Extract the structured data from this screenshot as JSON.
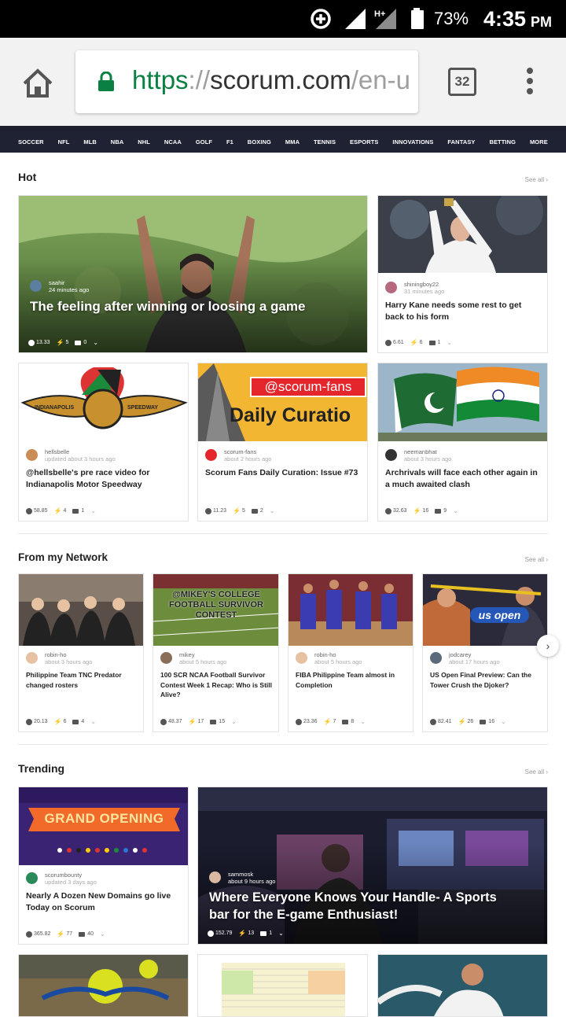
{
  "status_bar": {
    "battery": "73%",
    "time": "4:35",
    "ampm": "PM",
    "network": "H+"
  },
  "browser": {
    "url_scheme": "https",
    "url_sep": "://",
    "url_host": "scorum.com",
    "url_path": "/en-u",
    "tab_count": "32"
  },
  "sport_nav": [
    "SOCCER",
    "NFL",
    "MLB",
    "NBA",
    "NHL",
    "NCAA",
    "GOLF",
    "F1",
    "BOXING",
    "MMA",
    "TENNIS",
    "ESPORTS",
    "INNOVATIONS",
    "FANTASY",
    "BETTING",
    "MORE"
  ],
  "sections": {
    "hot": {
      "title": "Hot",
      "see_all": "See all ›"
    },
    "network": {
      "title": "From my Network",
      "see_all": "See all ›"
    },
    "trending": {
      "title": "Trending",
      "see_all": "See all ›"
    }
  },
  "hot_cards": [
    {
      "author": "saahir",
      "ago": "24 minutes ago",
      "title": "The feeling after winning or loosing a game",
      "payout": "13.33",
      "votes": "5",
      "comments": "0"
    },
    {
      "author": "shiningboy22",
      "ago": "31 minutes ago",
      "title": "Harry Kane needs some rest to get back to his form",
      "payout": "6.61",
      "votes": "6",
      "comments": "1"
    },
    {
      "author": "hellsbelle",
      "ago": "updated about 3 hours ago",
      "title": "@hellsbelle's pre race video for Indianapolis Motor Speedway",
      "payout": "58.85",
      "votes": "4",
      "comments": "1",
      "img_text": "INDIANAPOLIS MOTOR SPEEDWAY"
    },
    {
      "author": "scorum-fans",
      "ago": "about 2 hours ago",
      "title": "Scorum Fans Daily Curation: Issue #73",
      "payout": "11.23",
      "votes": "5",
      "comments": "2",
      "img_tag": "@scorum-fans",
      "img_text": "Daily Curatio"
    },
    {
      "author": "neemanbhat",
      "ago": "about 3 hours ago",
      "title": "Archrivals will face each other again in a much awaited clash",
      "payout": "32.63",
      "votes": "16",
      "comments": "9"
    }
  ],
  "network_cards": [
    {
      "author": "robin-ho",
      "ago": "about 3 hours ago",
      "title": "Philippine Team TNC Predator changed rosters",
      "payout": "20.13",
      "votes": "6",
      "comments": "4"
    },
    {
      "author": "mikey",
      "ago": "about 5 hours ago",
      "title": "100 SCR NCAA Football Survivor Contest Week 1 Recap: Who is Still Alive?",
      "payout": "48.37",
      "votes": "17",
      "comments": "15",
      "img_text": "@MIKEY'S COLLEGE FOOTBALL SURVIVOR CONTEST"
    },
    {
      "author": "robin-ho",
      "ago": "about 5 hours ago",
      "title": "FIBA Philippine Team almost in Completion",
      "payout": "23.36",
      "votes": "7",
      "comments": "8"
    },
    {
      "author": "jodcarey",
      "ago": "about 17 hours ago",
      "title": "US Open Final Preview: Can the Tower Crush the Djoker?",
      "payout": "82.41",
      "votes": "26",
      "comments": "16",
      "img_text": "us open"
    }
  ],
  "trending_cards": [
    {
      "author": "scorumbounty",
      "ago": "updated 3 days ago",
      "title": "Nearly A Dozen New Domains go live Today on Scorum",
      "payout": "365.82",
      "votes": "77",
      "comments": "40",
      "img_text": "GRAND OPENING"
    },
    {
      "author": "sammosk",
      "ago": "about 9 hours ago",
      "title": "Where Everyone Knows Your Handle- A Sports bar for the E-game Enthusiast!",
      "payout": "152.79",
      "votes": "13",
      "comments": "1"
    }
  ],
  "colors": {
    "nav_bg": "#1e2233",
    "url_green": "#0b8043",
    "background": "#ffffff"
  }
}
